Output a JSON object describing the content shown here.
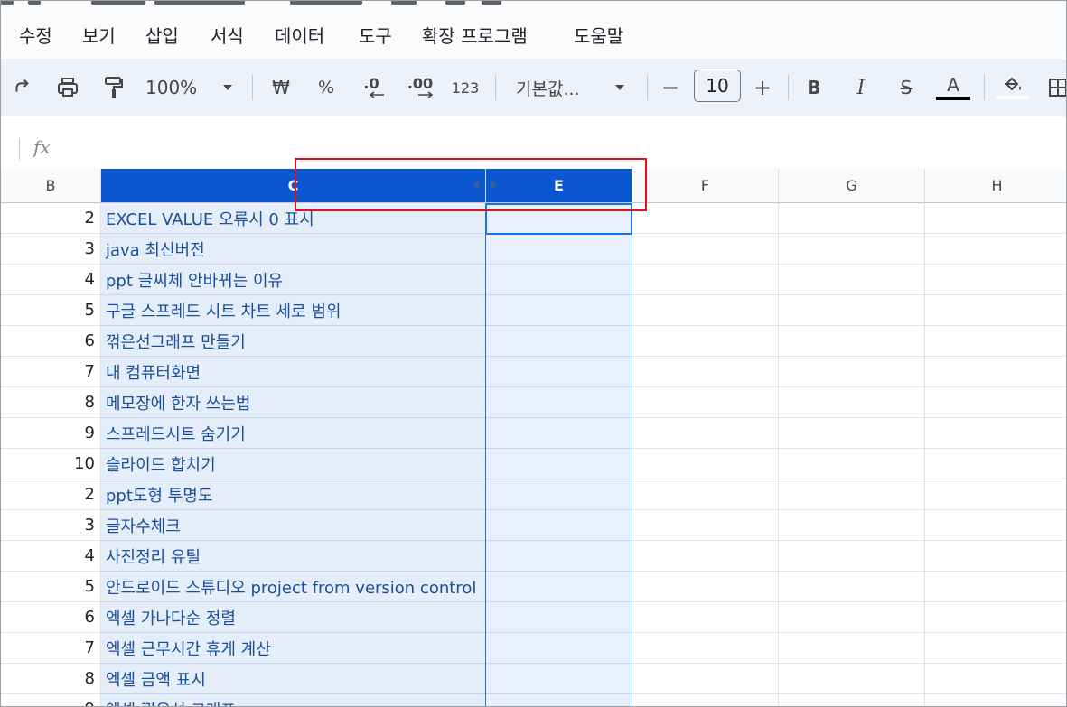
{
  "menu": [
    "수정",
    "보기",
    "삽입",
    "서식",
    "데이터",
    "도구",
    "확장 프로그램",
    "도움말"
  ],
  "toolbar": {
    "zoom": "100%",
    "currency": "₩",
    "percent": "%",
    "decrease_decimal": ".0",
    "increase_decimal": ".00",
    "number_format": "123",
    "font_name": "기본값...",
    "font_size": "10",
    "minus": "−",
    "plus": "+",
    "bold": "B",
    "italic": "I",
    "strike": "S",
    "text_color": "A"
  },
  "formula": {
    "fx": "fx"
  },
  "columns": {
    "b": "B",
    "c": "C",
    "e": "E",
    "f": "F",
    "g": "G",
    "h": "H"
  },
  "rows": [
    {
      "b": "2",
      "c": "EXCEL VALUE 오류시 0 표시"
    },
    {
      "b": "3",
      "c": "java 최신버전"
    },
    {
      "b": "4",
      "c": "ppt 글씨체 안바뀌는 이유"
    },
    {
      "b": "5",
      "c": "구글 스프레드 시트 차트 세로 범위"
    },
    {
      "b": "6",
      "c": "꺾은선그래프 만들기"
    },
    {
      "b": "7",
      "c": "내 컴퓨터화면"
    },
    {
      "b": "8",
      "c": "메모장에 한자 쓰는법"
    },
    {
      "b": "9",
      "c": "스프레드시트 숨기기"
    },
    {
      "b": "10",
      "c": "슬라이드 합치기"
    },
    {
      "b": "2",
      "c": "ppt도형 투명도"
    },
    {
      "b": "3",
      "c": "글자수체크"
    },
    {
      "b": "4",
      "c": "사진정리 유틸"
    },
    {
      "b": "5",
      "c": "안드로이드 스튜디오 project from version control"
    },
    {
      "b": "6",
      "c": "엑셀 가나다순 정렬"
    },
    {
      "b": "7",
      "c": "엑셀 근무시간 휴게 계산"
    },
    {
      "b": "8",
      "c": "엑셀 금액 표시"
    },
    {
      "b": "9",
      "c": "엑셀 꺾은선 그래프"
    }
  ],
  "colors": {
    "selected_header": "#0b57d0",
    "selection": "#1a73e8",
    "highlight": "#e5101f",
    "toolbar_bg": "#edf2fa"
  }
}
